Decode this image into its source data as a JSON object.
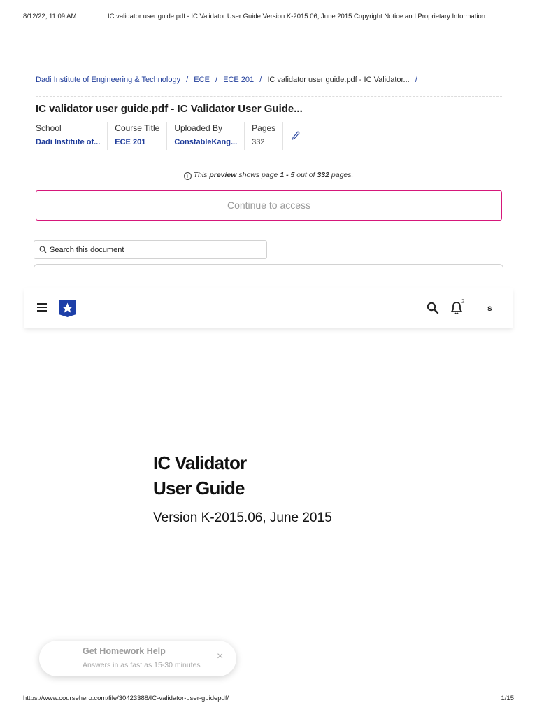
{
  "print_header": {
    "datetime": "8/12/22, 11:09 AM",
    "title": "IC validator user guide.pdf - IC Validator User Guide Version K-2015.06, June 2015 Copyright Notice and Proprietary Information..."
  },
  "breadcrumb": {
    "items": [
      "Dadi Institute of Engineering & Technology",
      "ECE",
      "ECE 201"
    ],
    "current": "IC validator user guide.pdf - IC Validator...",
    "separator": "/"
  },
  "document": {
    "heading": "IC validator user guide.pdf - IC Validator User Guide..."
  },
  "meta": {
    "school_label": "School",
    "school_value": "Dadi Institute of...",
    "course_label": "Course Title",
    "course_value": "ECE 201",
    "uploader_label": "Uploaded By",
    "uploader_value": "ConstableKang...",
    "pages_label": "Pages",
    "pages_value": "332",
    "edit_icon": "pencil-icon"
  },
  "preview": {
    "text_1": "This ",
    "bold_1": "preview",
    "text_2": " shows page ",
    "bold_2": "1 - 5",
    "text_3": " out of ",
    "bold_3": "332",
    "text_4": " pages."
  },
  "continue_button": "Continue to access",
  "search": {
    "placeholder": "Search this document",
    "icon": "search-icon"
  },
  "topnav": {
    "menu_icon": "hamburger-icon",
    "logo": "course-hero-logo",
    "search_icon": "search-icon",
    "bell_icon": "notification-bell-icon",
    "notification_count": "2",
    "avatar_letter": "s"
  },
  "cover": {
    "title_line1": "IC Validator",
    "title_line2": "User Guide",
    "version": "Version K-2015.06, June 2015"
  },
  "homework_toast": {
    "title": "Get Homework Help",
    "subtitle": "Answers in as fast as 15-30 minutes",
    "close": "×"
  },
  "print_footer": {
    "url": "https://www.coursehero.com/file/30423388/IC-validator-user-guidepdf/",
    "page": "1/15"
  },
  "colors": {
    "link_blue": "#1f3c9a",
    "accent_magenta": "#d6177a",
    "logo_blue": "#1d3fa8"
  }
}
